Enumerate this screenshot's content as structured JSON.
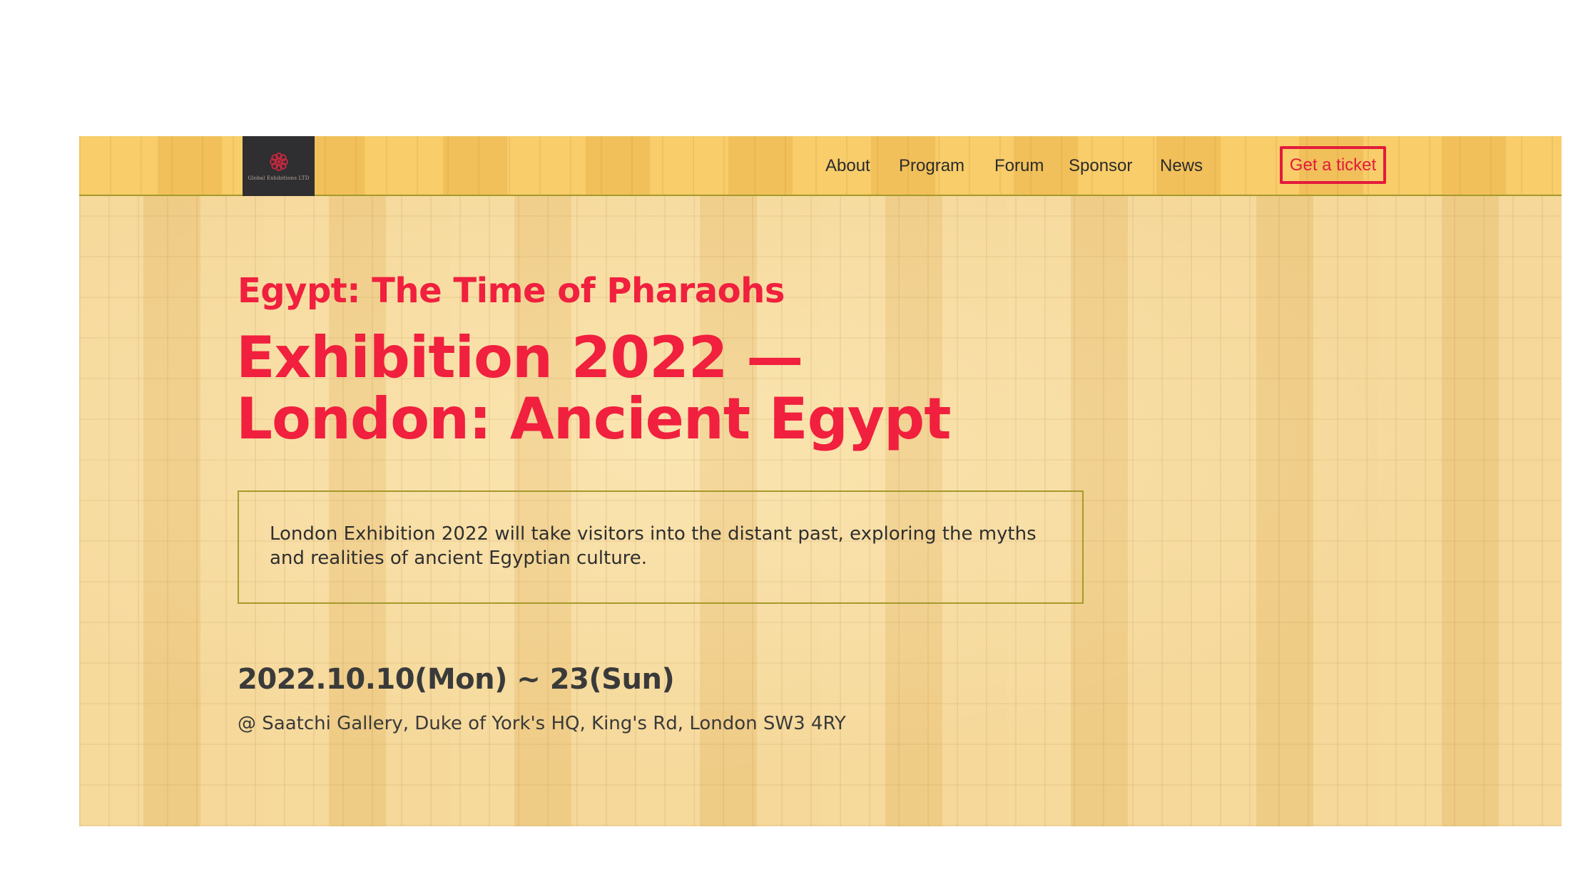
{
  "header": {
    "logo": {
      "icon": "flower-ornament-icon",
      "text": "Global Exhibitions LTD",
      "mark_color": "#c0293f"
    },
    "nav": [
      {
        "label": "About"
      },
      {
        "label": "Program"
      },
      {
        "label": "Forum"
      },
      {
        "label": "Sponsor"
      },
      {
        "label": "News"
      }
    ],
    "cta_label": "Get a ticket"
  },
  "hero": {
    "subtitle": "Egypt: The Time of Pharaohs",
    "title": "Exhibition 2022 — London: Ancient Egypt",
    "description": "London Exhibition 2022 will take visitors into the distant past, exploring the myths and realities of ancient Egyptian culture.",
    "date": "2022.10.10(Mon) ~ 23(Sun)",
    "venue": "@ Saatchi Gallery, Duke of York's HQ, King's Rd, London SW3 4RY"
  },
  "colors": {
    "accent": "#f0203e",
    "text": "#2f2f2f",
    "header_bg": "#f5c65f",
    "page_bg": "#f3d28e",
    "border": "#a59a2c",
    "logo_bg": "#2f2e30"
  }
}
